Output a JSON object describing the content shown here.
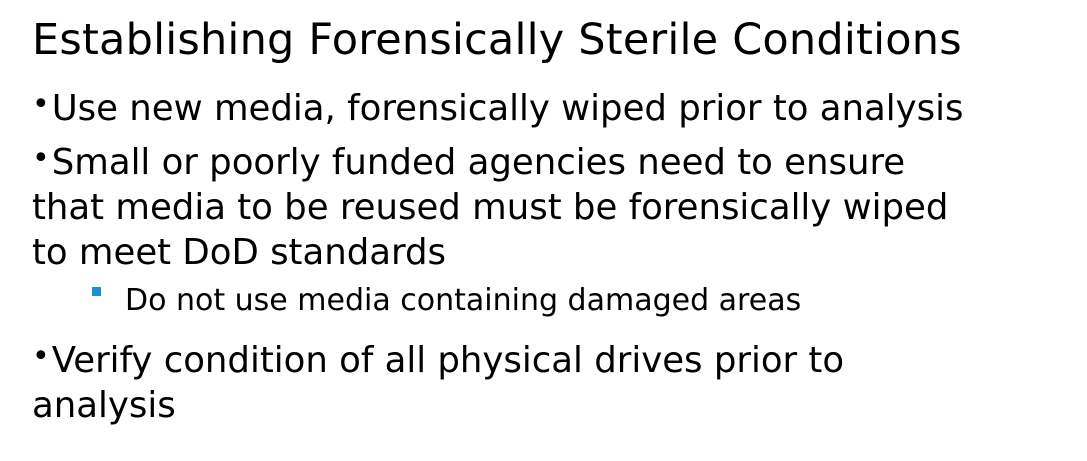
{
  "slide": {
    "title": "Establishing Forensically Sterile Conditions",
    "bullet_char": "•",
    "bullets": [
      {
        "lines": [
          "Use new media, forensically wiped prior to analysis"
        ]
      },
      {
        "lines": [
          "Small or poorly funded agencies need to ensure",
          "that media to be reused must be forensically wiped",
          "to meet DoD standards"
        ]
      },
      {
        "lines": [
          "Do not use media containing damaged areas"
        ]
      },
      {
        "lines": [
          "Verify condition of all physical drives prior to",
          "analysis"
        ]
      }
    ],
    "colors": {
      "text": "#000000",
      "sub_bullet_marker": "#1f8fd4",
      "background": "#ffffff"
    },
    "icons": {
      "sub_bullet": "square-bullet-icon"
    }
  }
}
